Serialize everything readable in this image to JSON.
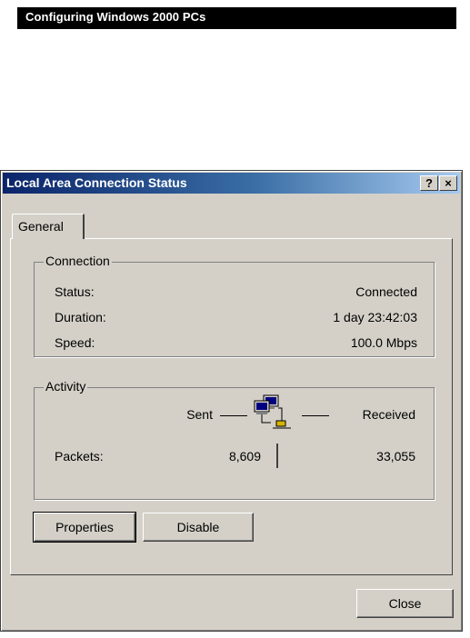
{
  "banner": {
    "text": "Configuring Windows 2000 PCs"
  },
  "dialog": {
    "title": "Local Area Connection Status",
    "help_button": "?",
    "close_button": "×",
    "tab_label": "General",
    "connection": {
      "legend": "Connection",
      "status_label": "Status:",
      "status_value": "Connected",
      "duration_label": "Duration:",
      "duration_value": "1 day 23:42:03",
      "speed_label": "Speed:",
      "speed_value": "100.0 Mbps"
    },
    "activity": {
      "legend": "Activity",
      "sent_label": "Sent",
      "received_label": "Received",
      "packets_label": "Packets:",
      "packets_sent": "8,609",
      "packets_received": "33,055"
    },
    "properties_button": "Properties",
    "disable_button": "Disable",
    "close_label": "Close"
  },
  "icons": {
    "network": "network-computers-icon"
  }
}
